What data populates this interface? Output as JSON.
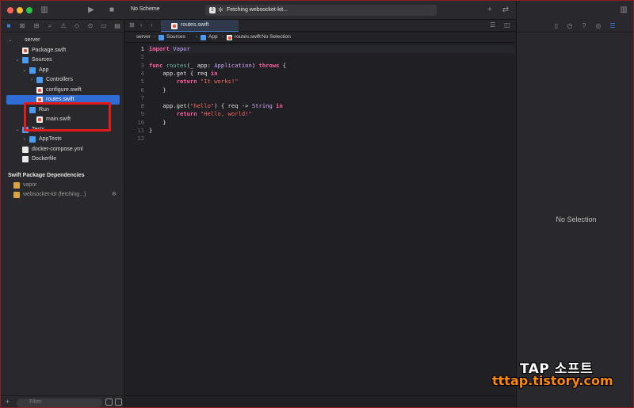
{
  "toolbar": {
    "scheme": "No Scheme",
    "activity_count": "2",
    "activity_message": "Fetching websocket-kit..."
  },
  "navigator": {
    "tree": [
      {
        "label": "server",
        "depth": 0,
        "kind": "package",
        "disclosure": "open"
      },
      {
        "label": "Package.swift",
        "depth": 1,
        "kind": "swift"
      },
      {
        "label": "Sources",
        "depth": 1,
        "kind": "folder",
        "disclosure": "open"
      },
      {
        "label": "App",
        "depth": 2,
        "kind": "folder",
        "disclosure": "open"
      },
      {
        "label": "Controllers",
        "depth": 3,
        "kind": "folder",
        "disclosure": "closed"
      },
      {
        "label": "configure.swift",
        "depth": 3,
        "kind": "swift"
      },
      {
        "label": "routes.swift",
        "depth": 3,
        "kind": "swift",
        "selected": true
      },
      {
        "label": "Run",
        "depth": 2,
        "kind": "folder",
        "disclosure": "open"
      },
      {
        "label": "main.swift",
        "depth": 3,
        "kind": "swift"
      },
      {
        "label": "Tests",
        "depth": 1,
        "kind": "folder",
        "disclosure": "open"
      },
      {
        "label": "AppTests",
        "depth": 2,
        "kind": "folder",
        "disclosure": "closed"
      },
      {
        "label": "docker-compose.yml",
        "depth": 1,
        "kind": "doc"
      },
      {
        "label": "Dockerfile",
        "depth": 1,
        "kind": "doc"
      }
    ],
    "dependencies_title": "Swift Package Dependencies",
    "dependencies": [
      {
        "label": "vapor"
      },
      {
        "label": "websocket-kit (fetching...)"
      }
    ],
    "filter_placeholder": "Filter"
  },
  "editor": {
    "tab_label": "routes.swift",
    "jumpbar": [
      {
        "label": "server",
        "kind": "package"
      },
      {
        "label": "Sources",
        "kind": "folder"
      },
      {
        "label": "App",
        "kind": "folder"
      },
      {
        "label": "routes.swift",
        "kind": "swift"
      },
      {
        "label": "No Selection",
        "kind": "none"
      }
    ],
    "lines": [
      "import Vapor",
      "",
      "func routes(_ app: Application) throws {",
      "    app.get { req in",
      "        return \"It works!\"",
      "    }",
      "",
      "    app.get(\"hello\") { req -> String in",
      "        return \"Hello, world!\"",
      "    }",
      "}",
      ""
    ],
    "line_numbers": [
      "1",
      "2",
      "3",
      "4",
      "5",
      "6",
      "7",
      "8",
      "9",
      "10",
      "11",
      "12"
    ],
    "current_line": 1
  },
  "inspector": {
    "empty_label": "No Selection"
  },
  "watermark": {
    "line1": "TAP 소프트",
    "line2": "tttap.tistory.com"
  },
  "colors": {
    "accent": "#2f6cd6",
    "keyword": "#fc5fa3",
    "string": "#fc6a5d",
    "type": "#d0a8ff",
    "function": "#67b7a4",
    "highlight_box": "#e11b1b"
  }
}
